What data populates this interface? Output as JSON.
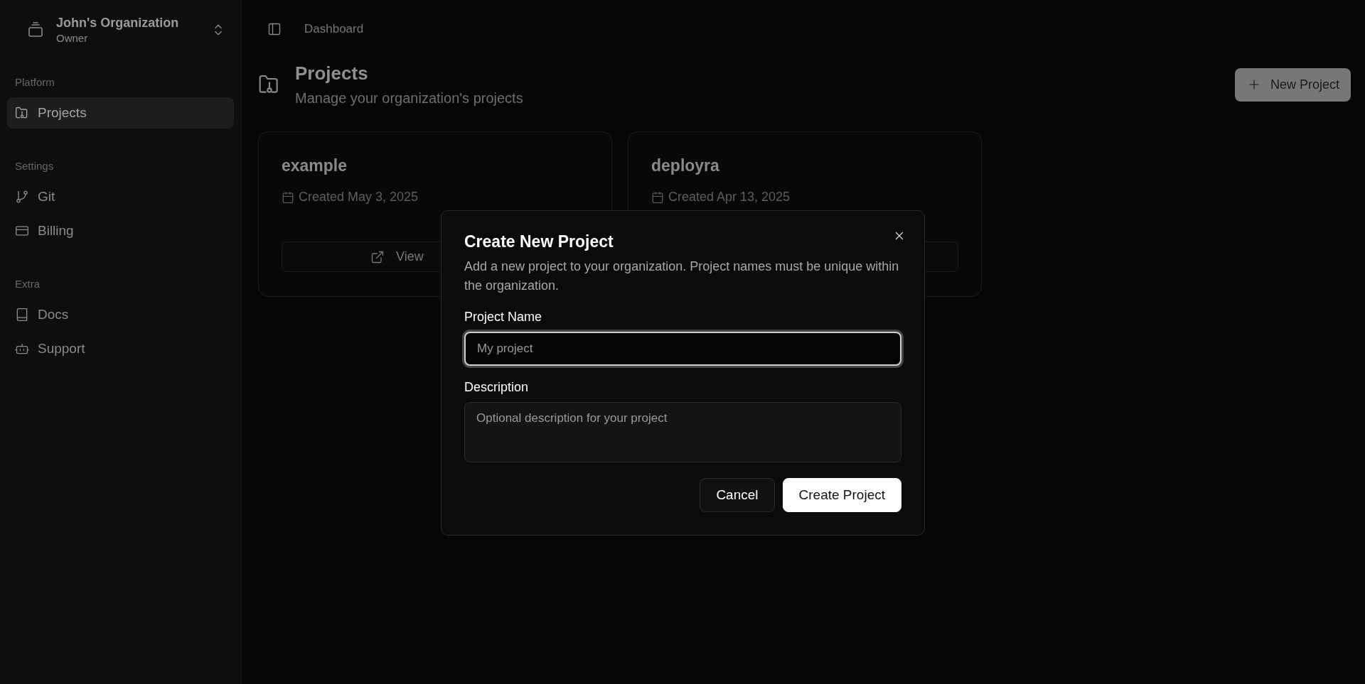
{
  "sidebar": {
    "org": {
      "name": "John's Organization",
      "role": "Owner"
    },
    "sections": [
      {
        "label": "Platform",
        "items": [
          {
            "label": "Projects",
            "selected": true
          }
        ]
      },
      {
        "label": "Settings",
        "items": [
          {
            "label": "Git",
            "selected": false
          },
          {
            "label": "Billing",
            "selected": false
          }
        ]
      },
      {
        "label": "Extra",
        "items": [
          {
            "label": "Docs",
            "selected": false
          },
          {
            "label": "Support",
            "selected": false
          }
        ]
      }
    ]
  },
  "topbar": {
    "breadcrumb": "Dashboard"
  },
  "page": {
    "title": "Projects",
    "subtitle": "Manage your organization's projects",
    "new_button": "New Project"
  },
  "projects": [
    {
      "name": "example",
      "created": "Created May 3, 2025",
      "button_label": "View"
    },
    {
      "name": "deployra",
      "created": "Created Apr 13, 2025"
    }
  ],
  "dialog": {
    "title": "Create New Project",
    "description": "Add a new project to your organization. Project names must be unique within the organization.",
    "fields": [
      {
        "kind": "input",
        "label": "Project Name",
        "placeholder": "My project",
        "focused": true
      },
      {
        "kind": "textarea",
        "label": "Description",
        "placeholder": "Optional description for your project",
        "focused": false
      }
    ],
    "buttons": [
      {
        "kind": "secondary",
        "label": "Cancel"
      },
      {
        "kind": "primary",
        "label": "Create Project"
      }
    ]
  }
}
